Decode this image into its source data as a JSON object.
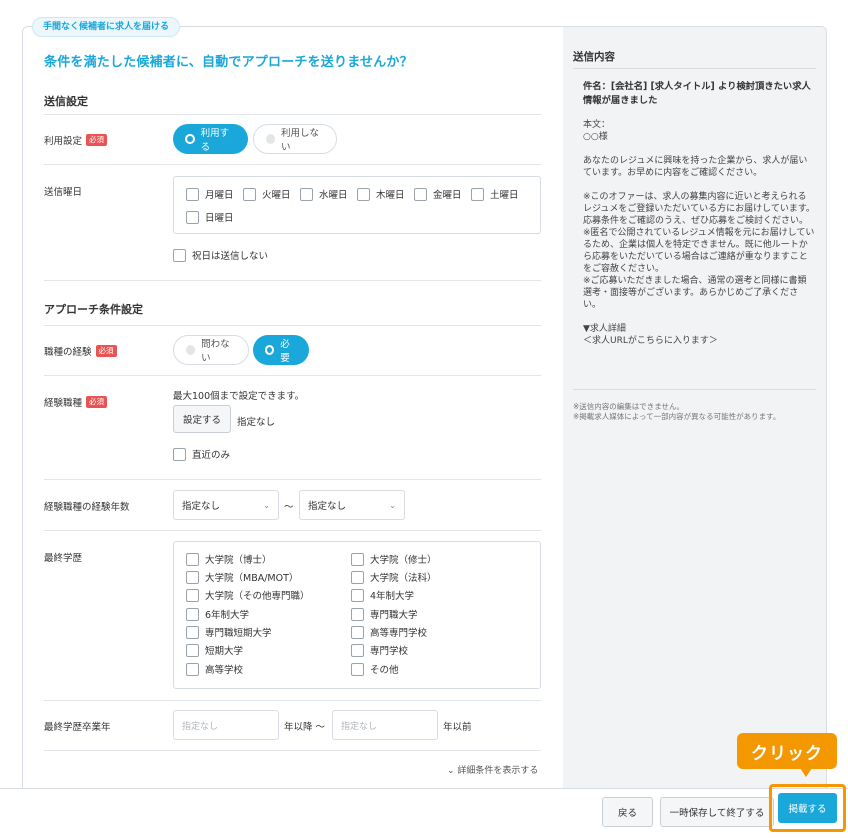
{
  "tab_label": "手間なく候補者に求人を届ける",
  "headline": "条件を満たした候補者に、自動でアプローチを送りませんか？",
  "send_settings": {
    "title": "送信設定",
    "usage": {
      "label": "利用設定",
      "required": "必須",
      "on_label": "利用する",
      "off_label": "利用しない",
      "selected": "利用する"
    },
    "weekday": {
      "label": "送信曜日",
      "days": [
        "月曜日",
        "火曜日",
        "水曜日",
        "木曜日",
        "金曜日",
        "土曜日",
        "日曜日"
      ],
      "holiday_label": "祝日は送信しない"
    }
  },
  "approach": {
    "title": "アプローチ条件設定",
    "experience": {
      "label": "職種の経験",
      "required": "必須",
      "off_label": "問わない",
      "on_label": "必要",
      "selected": "必要"
    },
    "job_types": {
      "label": "経験職種",
      "required": "必須",
      "note": "最大100個まで設定できます。",
      "set_button": "設定する",
      "value": "指定なし",
      "recent_label": "直近のみ"
    },
    "years": {
      "label": "経験職種の経験年数",
      "from": "指定なし",
      "separator": "〜",
      "to": "指定なし"
    },
    "education": {
      "label": "最終学歴",
      "left": [
        "大学院（博士）",
        "大学院（MBA/MOT）",
        "大学院（その他専門職）",
        "6年制大学",
        "専門職短期大学",
        "短期大学",
        "高等学校"
      ],
      "right": [
        "大学院（修士）",
        "大学院（法科）",
        "4年制大学",
        "専門職大学",
        "高等専門学校",
        "専門学校",
        "その他"
      ]
    },
    "graduation": {
      "label": "最終学歴卒業年",
      "from_placeholder": "指定なし",
      "after": "年以降",
      "separator": "〜",
      "to_placeholder": "指定なし",
      "before": "年以前"
    },
    "more_link": "詳細条件を表示する"
  },
  "preview": {
    "title": "送信内容",
    "subject": "件名：[会社名] [求人タイトル] より検討頂きたい求人情報が届きました",
    "body": "本文：\n○○様\n\nあなたのレジュメに興味を持った企業から、求人が届いています。お早めに内容をご確認ください。\n\n※このオファーは、求人の募集内容に近いと考えられるレジュメをご登録いただいている方にお届けしています。応募条件をご確認のうえ、ぜひ応募をご検討ください。\n※匿名で公開されているレジュメ情報を元にお届けしているため、企業は個人を特定できません。既に他ルートから応募をいただいている場合はご連絡が重なりますことをご容赦ください。\n※ご応募いただきました場合、通常の選考と同様に書類選考・面接等がございます。あらかじめご了承ください。\n\n▼求人詳細\n＜求人URLがこちらに入ります＞",
    "footnote": "※送信内容の編集はできません。\n※掲載求人媒体によって一部内容が異なる可能性があります。"
  },
  "footer": {
    "back": "戻る",
    "save_draft": "一時保存して終了する",
    "publish": "掲載する"
  },
  "callout": "クリック",
  "colors": {
    "accent": "#1aa7d9",
    "required": "#e85454",
    "highlight": "#f39800"
  }
}
